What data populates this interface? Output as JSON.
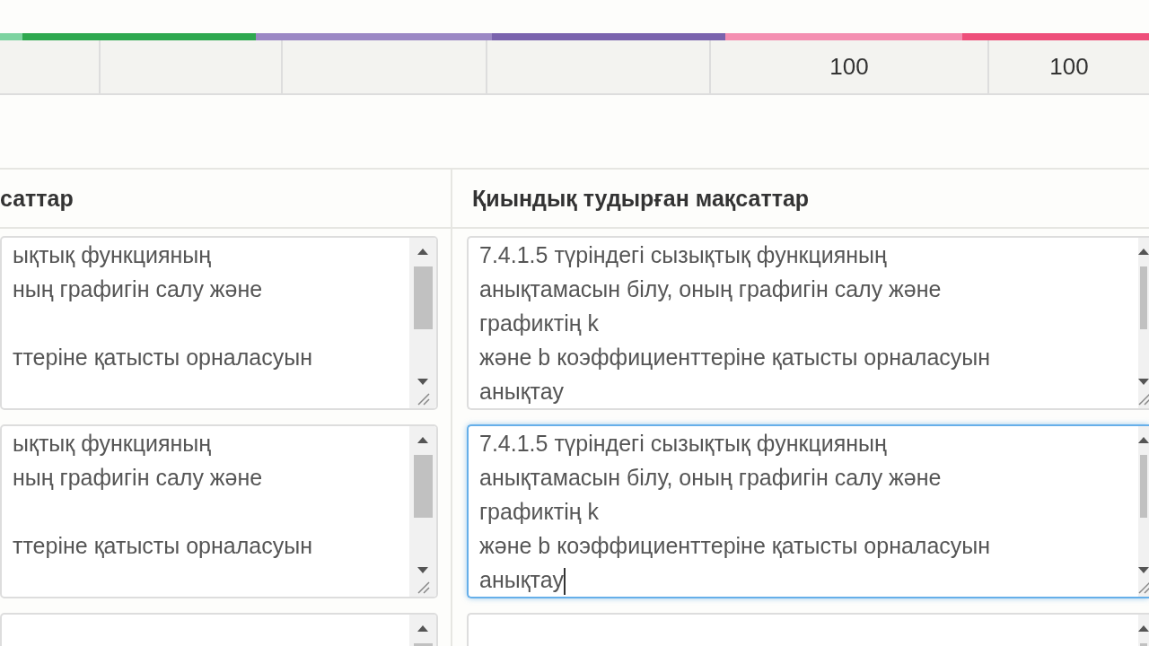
{
  "color_bar": [
    {
      "color": "#7dd3a0"
    },
    {
      "color": "#2ea84f"
    },
    {
      "color": "#9b88c4"
    },
    {
      "color": "#7a63ad"
    },
    {
      "color": "#f48fb1"
    },
    {
      "color": "#ee4f7a"
    }
  ],
  "score_row": [
    {
      "kind": "empty"
    },
    {
      "kind": "empty"
    },
    {
      "kind": "empty"
    },
    {
      "kind": "empty"
    },
    {
      "kind": "value",
      "value": "100"
    },
    {
      "kind": "value",
      "value": "100"
    }
  ],
  "table": {
    "columns": [
      "саттар",
      "Қиындық тудырған мақсаттар"
    ],
    "rows": [
      {
        "left": {
          "value": "ықтық функцияның\nның графигін салу және\n\nттеріне қатысты орналасуын",
          "focused": false
        },
        "right": {
          "value": "7.4.1.5 түріндегі сызықтық функцияның\nанықтамасын білу, оның графигін салу және\nграфиктің k\nжәне b коэффициенттеріне қатысты орналасуын\nанықтау",
          "focused": false
        }
      },
      {
        "left": {
          "value": "ықтық функцияның\nның графигін салу және\n\nттеріне қатысты орналасуын",
          "focused": false
        },
        "right": {
          "value": "7.4.1.5 түріндегі сызықтық функцияның\nанықтамасын білу, оның графигін салу және\nграфиктің k\nжәне b коэффициенттеріне қатысты орналасуын\nанықтау",
          "focused": true
        }
      },
      {
        "left": {
          "focused": false
        },
        "right": {
          "focused": false
        }
      }
    ]
  }
}
